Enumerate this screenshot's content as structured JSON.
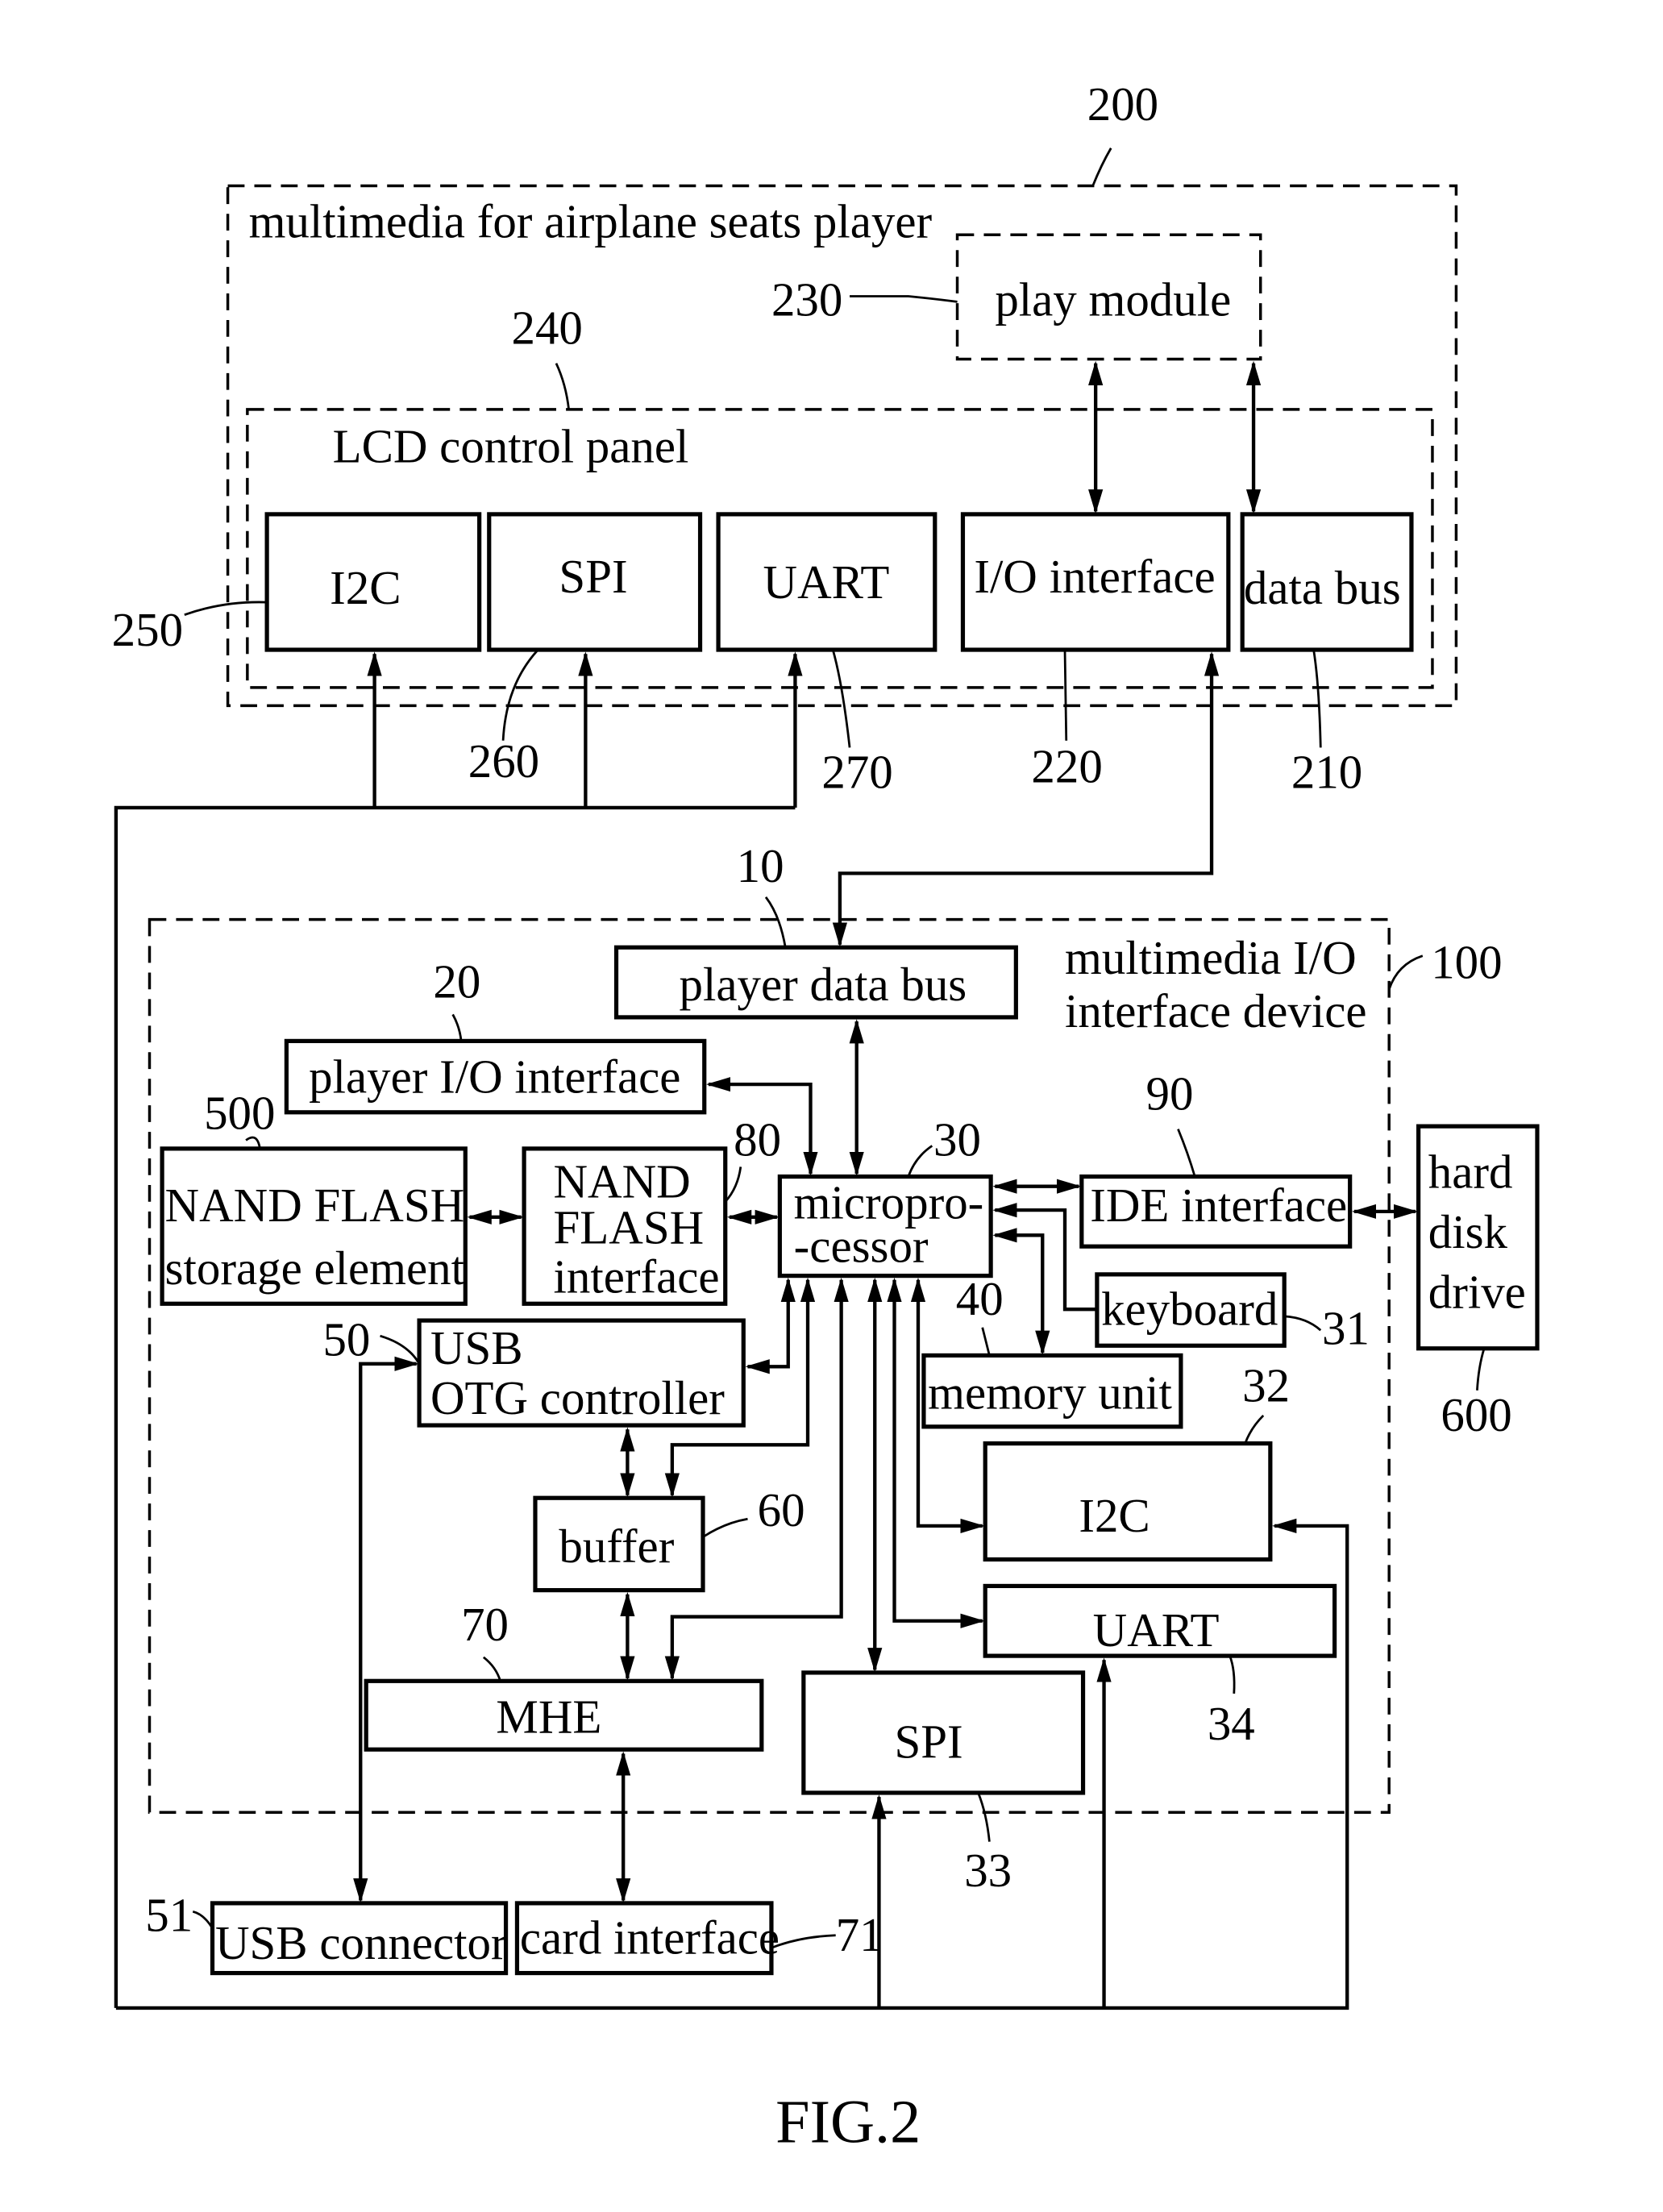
{
  "figure_label": "FIG.2",
  "player": {
    "ref": "200",
    "title": "multimedia for airplane seats player",
    "play_module": {
      "ref": "230",
      "label": "play module"
    },
    "lcd_panel": {
      "ref": "240",
      "title": "LCD control panel",
      "blocks": [
        {
          "ref": "250",
          "label": "I2C"
        },
        {
          "ref": "260",
          "label": "SPI"
        },
        {
          "ref": "270",
          "label": "UART"
        },
        {
          "ref": "220",
          "label": "I/O interface"
        },
        {
          "ref": "210",
          "label": "data bus"
        }
      ]
    }
  },
  "device": {
    "ref": "100",
    "title_line1": "multimedia I/O",
    "title_line2": "interface device",
    "blocks": {
      "player_data_bus": {
        "ref": "10",
        "label": "player data bus"
      },
      "player_io_interface": {
        "ref": "20",
        "label": "player I/O interface"
      },
      "microprocessor": {
        "ref": "30",
        "line1": "micropro-",
        "line2": "-cessor"
      },
      "keyboard": {
        "ref": "31",
        "label": "keyboard"
      },
      "i2c": {
        "ref": "32",
        "label": "I2C"
      },
      "spi": {
        "ref": "33",
        "label": "SPI"
      },
      "uart": {
        "ref": "34",
        "label": "UART"
      },
      "memory_unit": {
        "ref": "40",
        "label": "memory unit"
      },
      "usb_otg": {
        "ref": "50",
        "line1": "USB",
        "line2": "OTG controller"
      },
      "buffer": {
        "ref": "60",
        "label": "buffer"
      },
      "mhe": {
        "ref": "70",
        "label": "MHE"
      },
      "nand_interface": {
        "ref": "80",
        "line1": "NAND",
        "line2": "FLASH",
        "line3": "interface"
      },
      "ide_interface": {
        "ref": "90",
        "label": "IDE interface"
      }
    }
  },
  "external": {
    "nand_storage": {
      "ref": "500",
      "line1": "NAND FLASH",
      "line2": "storage element"
    },
    "hard_disk": {
      "ref": "600",
      "line1": "hard",
      "line2": "disk",
      "line3": "drive"
    },
    "usb_connector": {
      "ref": "51",
      "label": "USB connector"
    },
    "card_interface": {
      "ref": "71",
      "label": "card interface"
    }
  }
}
